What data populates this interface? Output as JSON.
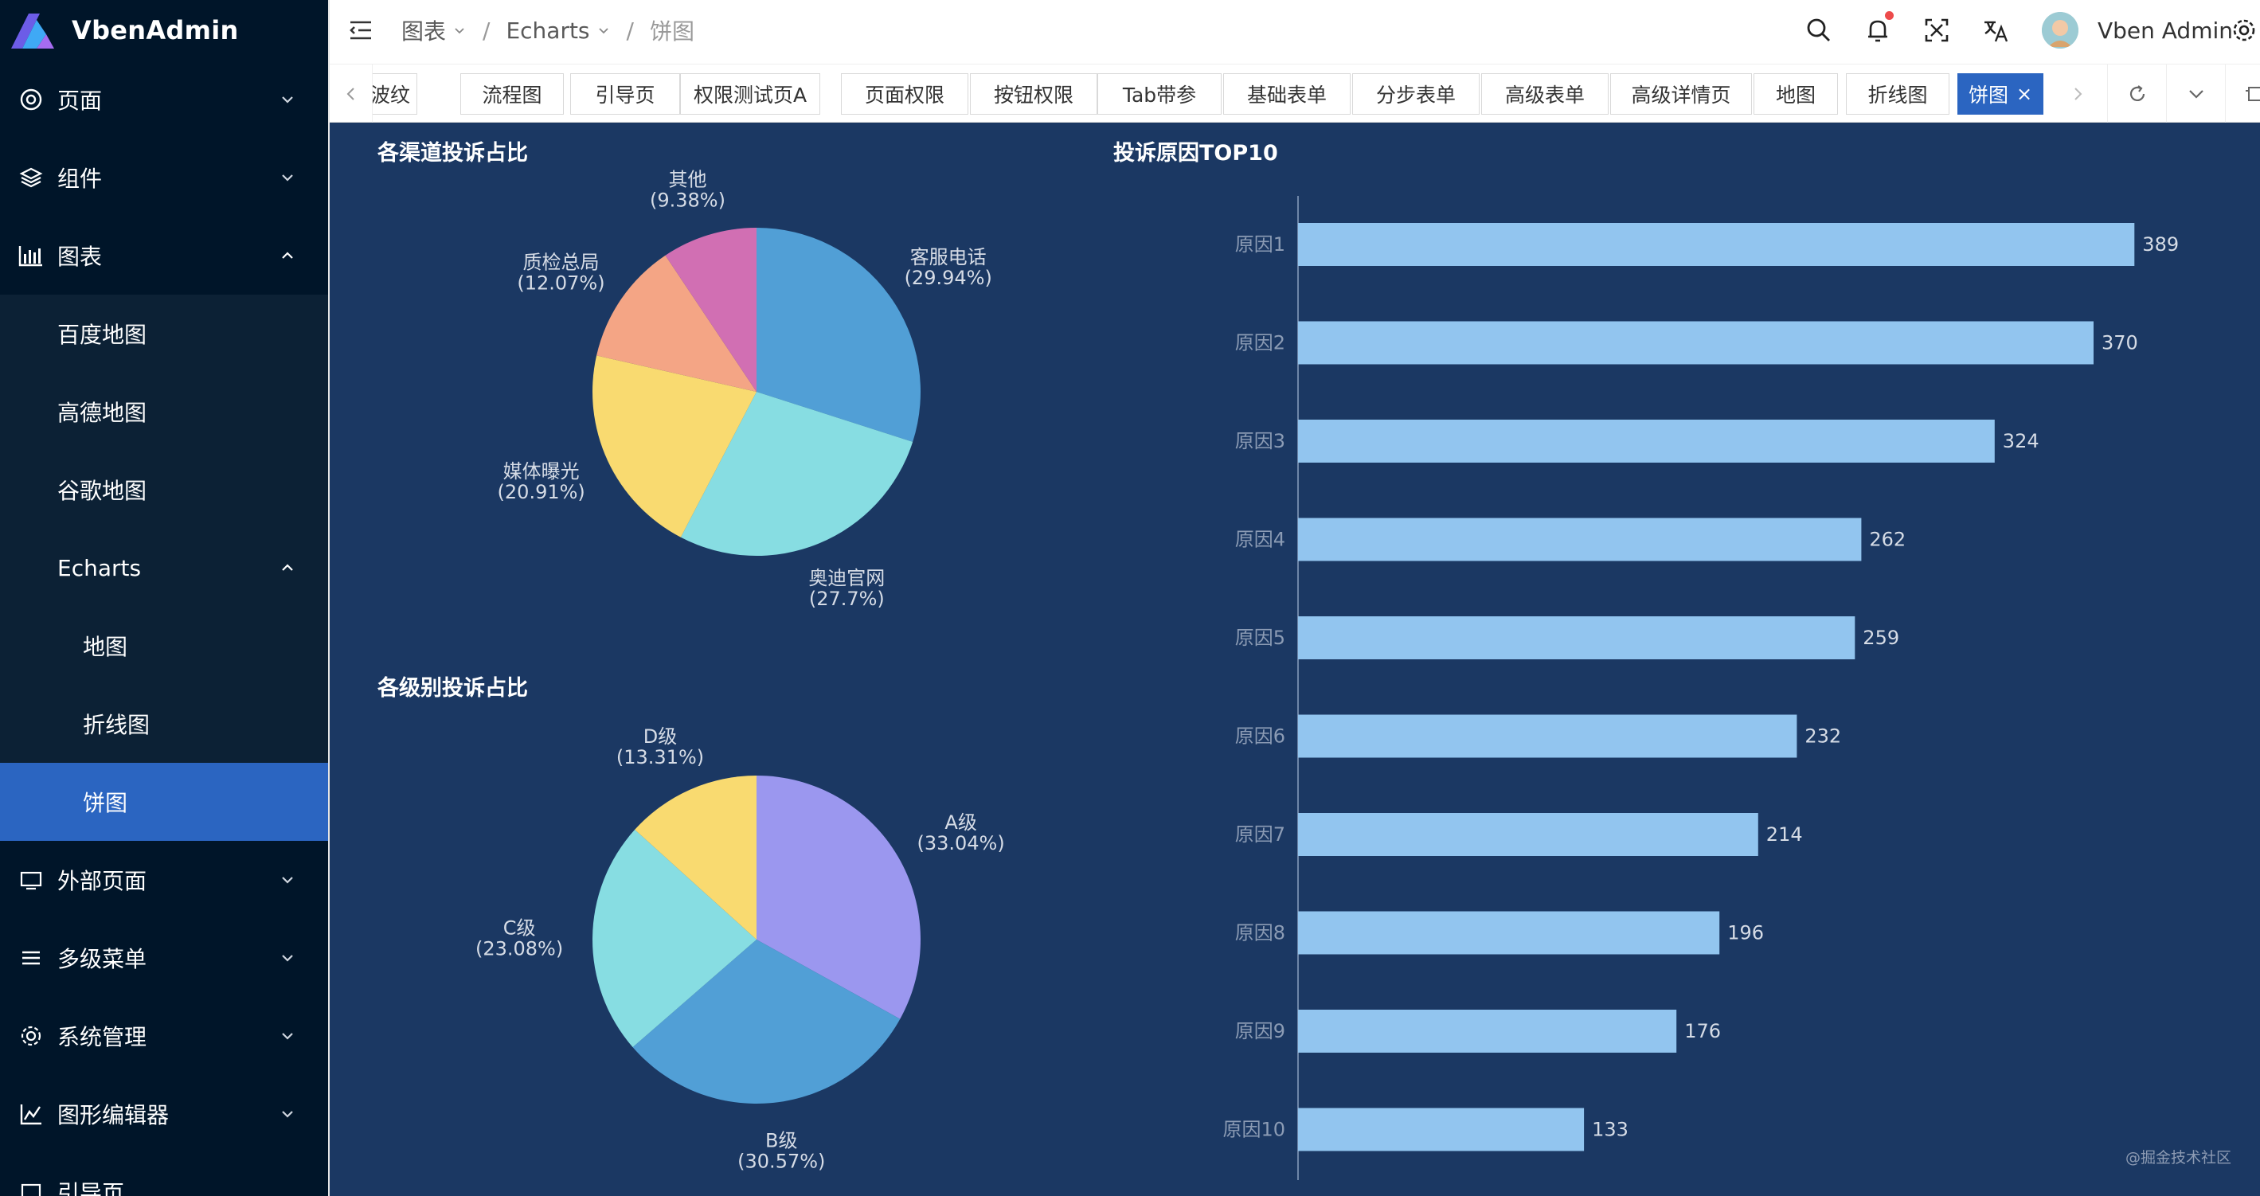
{
  "app": {
    "title": "VbenAdmin"
  },
  "sidebar": {
    "items": [
      {
        "label": "页面",
        "icon": "target-icon",
        "expanded": false
      },
      {
        "label": "组件",
        "icon": "layers-icon",
        "expanded": false
      },
      {
        "label": "图表",
        "icon": "bar-chart-icon",
        "expanded": true
      },
      {
        "label": "百度地图"
      },
      {
        "label": "高德地图"
      },
      {
        "label": "谷歌地图"
      },
      {
        "label": "Echarts",
        "expanded": true
      },
      {
        "label": "地图"
      },
      {
        "label": "折线图"
      },
      {
        "label": "饼图",
        "active": true
      },
      {
        "label": "外部页面",
        "icon": "monitor-icon",
        "expanded": false
      },
      {
        "label": "多级菜单",
        "icon": "menu-lines-icon",
        "expanded": false
      },
      {
        "label": "系统管理",
        "icon": "gear-icon",
        "expanded": false
      },
      {
        "label": "图形编辑器",
        "icon": "line-chart-icon",
        "expanded": false
      },
      {
        "label": "引导页",
        "icon": "guide-icon"
      }
    ]
  },
  "header": {
    "breadcrumb": [
      "图表",
      "Echarts",
      "饼图"
    ],
    "username": "Vben Admin"
  },
  "tabs": {
    "items": [
      "水波纹",
      "流程图",
      "引导页",
      "权限测试页A",
      "页面权限",
      "按钮权限",
      "Tab带参",
      "基础表单",
      "分步表单",
      "高级表单",
      "高级详情页",
      "地图",
      "折线图",
      "饼图"
    ],
    "active": "饼图",
    "close_glyph": "×"
  },
  "charts": {
    "watermark": "@掘金技术社区"
  },
  "chart_data": [
    {
      "type": "pie",
      "title": "各渠道投诉占比",
      "series": [
        {
          "name": "客服电话",
          "value": 29.94,
          "label": "(29.94%)",
          "color": "#519fd6"
        },
        {
          "name": "奥迪官网",
          "value": 27.7,
          "label": "(27.7%)",
          "color": "#87dde2"
        },
        {
          "name": "媒体曝光",
          "value": 20.91,
          "label": "(20.91%)",
          "color": "#f9da70"
        },
        {
          "name": "质检总局",
          "value": 12.07,
          "label": "(12.07%)",
          "color": "#f4a585"
        },
        {
          "name": "其他",
          "value": 9.38,
          "label": "(9.38%)",
          "color": "#d16fb3"
        }
      ]
    },
    {
      "type": "pie",
      "title": "各级别投诉占比",
      "series": [
        {
          "name": "A级",
          "value": 33.04,
          "label": "(33.04%)",
          "color": "#9b97ef"
        },
        {
          "name": "B级",
          "value": 30.57,
          "label": "(30.57%)",
          "color": "#519fd6"
        },
        {
          "name": "C级",
          "value": 23.08,
          "label": "(23.08%)",
          "color": "#87dde2"
        },
        {
          "name": "D级",
          "value": 13.31,
          "label": "(13.31%)",
          "color": "#f9da70"
        }
      ]
    },
    {
      "type": "bar",
      "orientation": "horizontal",
      "title": "投诉原因TOP10",
      "categories": [
        "原因1",
        "原因2",
        "原因3",
        "原因4",
        "原因5",
        "原因6",
        "原因7",
        "原因8",
        "原因9",
        "原因10"
      ],
      "values": [
        389,
        370,
        324,
        262,
        259,
        232,
        214,
        196,
        176,
        133
      ],
      "xlim": [
        0,
        400
      ],
      "color": "#92c5ef",
      "grid": false
    }
  ]
}
